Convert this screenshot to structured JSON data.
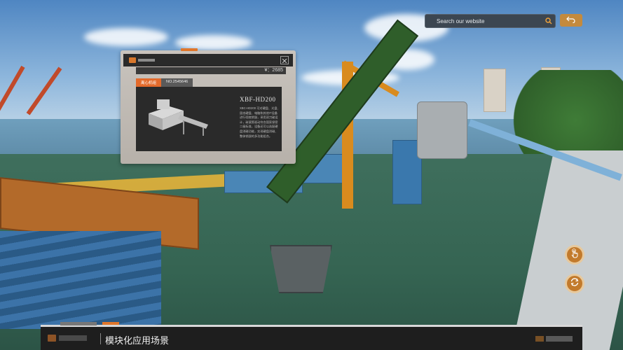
{
  "search": {
    "placeholder": "Search our website"
  },
  "popup": {
    "price": "¥：2685",
    "category_tag": "离心机组",
    "number_tag": "NO.2545646",
    "product_title": "XBF-HD200",
    "product_description": "XBC-HD200 可对硬盘、光盘、固态硬盘、电脑和其他IT设备进行彻底销毁，采用双刀破设计，碳滚筒驱动符合国家保密二级标准，设备还可以选配硬盘消磁功能，实现硬盘消磁、整体销毁的多功能组合。"
  },
  "caption": {
    "text": "模块化应用场景"
  },
  "colors": {
    "accent": "#e0762a",
    "button": "#c27a2c",
    "button_ring": "#e7c99d"
  },
  "icons": {
    "search": "search-icon",
    "back": "back-arrow-icon",
    "close": "close-icon",
    "touch": "hand-tap-icon",
    "refresh": "refresh-icon"
  }
}
